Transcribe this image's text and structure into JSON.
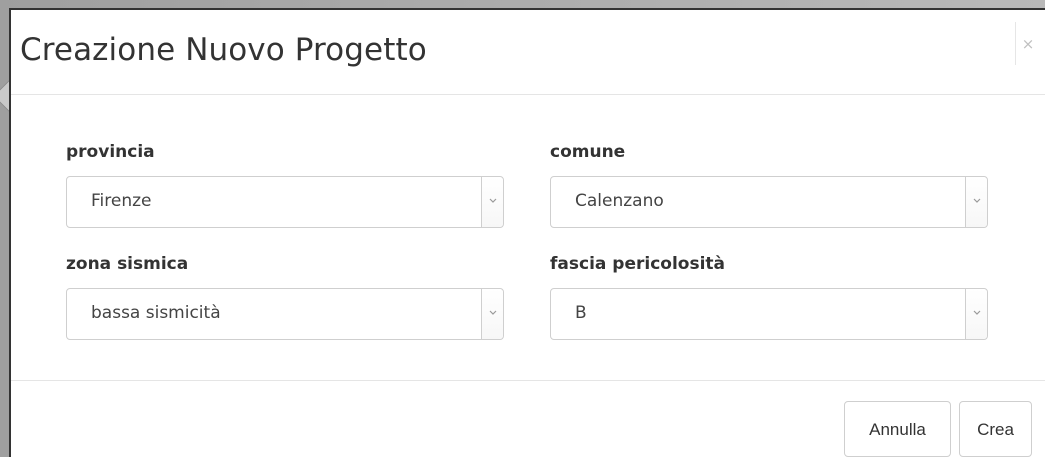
{
  "dialog": {
    "title": "Creazione Nuovo Progetto",
    "close_label": "×"
  },
  "form": {
    "fields": [
      {
        "label": "provincia",
        "value": "Firenze",
        "icon": "chevron-down-icon"
      },
      {
        "label": "comune",
        "value": "Calenzano",
        "icon": "chevron-down-icon"
      },
      {
        "label": "zona sismica",
        "value": "bassa sismicità",
        "icon": "chevron-down-icon"
      },
      {
        "label": "fascia pericolosità",
        "value": "B",
        "icon": "chevron-down-icon"
      }
    ]
  },
  "footer": {
    "cancel_label": "Annulla",
    "create_label": "Crea"
  }
}
